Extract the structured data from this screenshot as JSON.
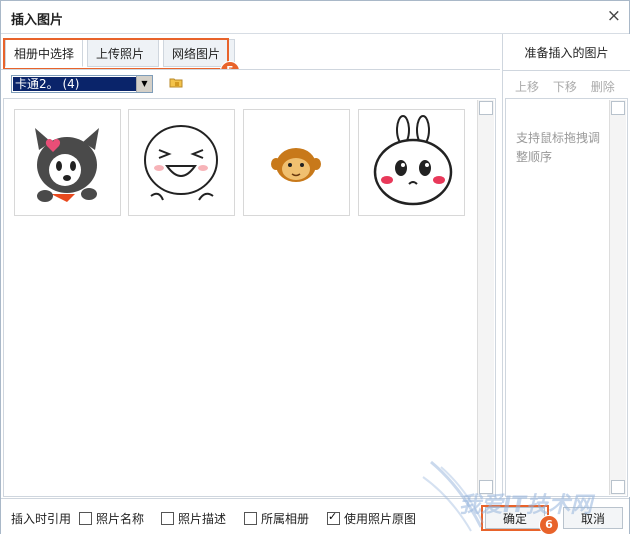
{
  "dialog": {
    "title": "插入图片",
    "close_glyph": "×"
  },
  "tabs": [
    {
      "label": "相册中选择",
      "active": true
    },
    {
      "label": "上传照片",
      "active": false
    },
    {
      "label": "网络图片",
      "active": false
    }
  ],
  "step_marks": {
    "tabs": "5",
    "confirm": "6"
  },
  "toolbar": {
    "album_select_value": "卡通2。 (4)",
    "folder_icon": "folder-lock-icon"
  },
  "gallery": {
    "images": [
      {
        "name": "gray-dog-sticker"
      },
      {
        "name": "white-bun-laughing-sticker"
      },
      {
        "name": "orange-monkey-sticker"
      },
      {
        "name": "white-rabbit-sticker"
      }
    ]
  },
  "right_panel": {
    "title": "准备插入的图片",
    "actions": [
      "上移",
      "下移",
      "删除"
    ],
    "hint": "支持鼠标拖拽调整顺序"
  },
  "footer": {
    "insert_label": "插入时引用",
    "options": [
      {
        "label": "照片名称",
        "checked": false
      },
      {
        "label": "照片描述",
        "checked": false
      },
      {
        "label": "所属相册",
        "checked": false
      },
      {
        "label": "使用照片原图",
        "checked": true
      }
    ],
    "confirm_label": "确定",
    "cancel_label": "取消"
  },
  "watermark": {
    "text": "我爱IT技术网"
  },
  "colors": {
    "highlight": "#e8632b",
    "selection": "#0a246a",
    "border": "#cfd6de"
  }
}
